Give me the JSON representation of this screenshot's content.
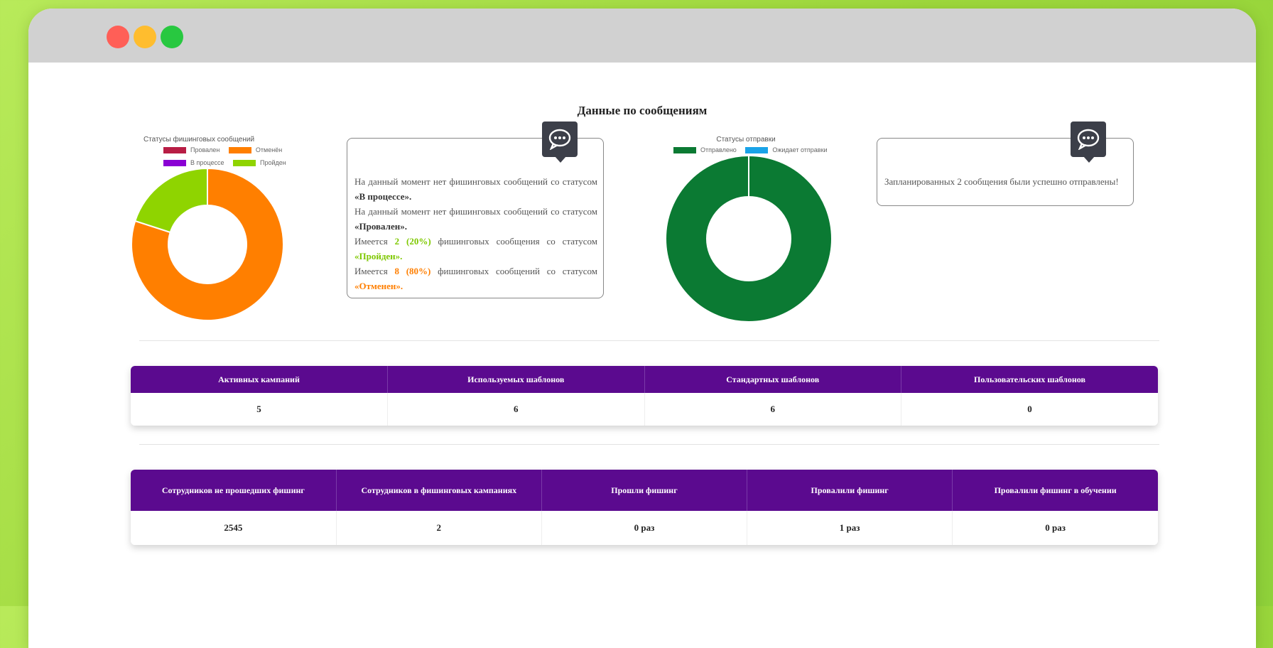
{
  "window": {
    "controls": {
      "close_color": "#ff5f57",
      "minimize_color": "#ffbd2e",
      "maximize_color": "#28c840"
    }
  },
  "section_title": "Данные по сообщениям",
  "phishing_status_chart": {
    "title": "Статусы фишинговых сообщений",
    "legend": [
      {
        "label": "Провален",
        "color": "#b81d45"
      },
      {
        "label": "Отменён",
        "color": "#ff7f00"
      },
      {
        "label": "В процессе",
        "color": "#8a00d4"
      },
      {
        "label": "Пройден",
        "color": "#8fd400"
      }
    ]
  },
  "send_status_chart": {
    "title": "Статусы отправки",
    "legend": [
      {
        "label": "Отправлено",
        "color": "#0b7a33"
      },
      {
        "label": "Ожидает отправки",
        "color": "#1aa3e8"
      }
    ]
  },
  "chart_data": [
    {
      "type": "pie",
      "title": "Статусы фишинговых сообщений",
      "categories": [
        "Провален",
        "Отменён",
        "В процессе",
        "Пройден"
      ],
      "values": [
        0,
        8,
        0,
        2
      ],
      "colors": [
        "#b81d45",
        "#ff7f00",
        "#8a00d4",
        "#8fd400"
      ],
      "legend": "top"
    },
    {
      "type": "pie",
      "title": "Статусы отправки",
      "categories": [
        "Отправлено",
        "Ожидает отправки"
      ],
      "values": [
        2,
        0
      ],
      "colors": [
        "#0b7a33",
        "#1aa3e8"
      ],
      "legend": "top"
    }
  ],
  "info_box_phishing": {
    "icon": "chat-bubble-icon",
    "line1_text": "На данный момент нет фишинговых сообщений со статусом ",
    "line1_status": "«В процессе».",
    "line2_text": "На данный момент нет фишинговых сообщений со статусом ",
    "line2_status": "«Провален».",
    "line3_prefix": "Имеется ",
    "line3_count": "2",
    "line3_percent": "(20%)",
    "line3_text": " фишинговых сообщения со статусом ",
    "line3_status": "«Пройден».",
    "line4_prefix": "Имеется ",
    "line4_count": "8",
    "line4_percent": "(80%)",
    "line4_text": " фишинговых сообщений со статусом ",
    "line4_status": "«Отменен».",
    "passed_color": "#7ec800",
    "cancelled_color": "#ff7f00"
  },
  "info_box_send": {
    "icon": "chat-bubble-icon",
    "text": "Запланированных 2 сообщения были успешно отправлены!"
  },
  "campaign_table": {
    "headers": [
      "Активных кампаний",
      "Используемых шаблонов",
      "Стандартных шаблонов",
      "Пользовательских шаблонов"
    ],
    "values": [
      "5",
      "6",
      "6",
      "0"
    ],
    "header_color": "#5b0a8f"
  },
  "employee_table": {
    "headers": [
      "Сотрудников не прошедших фишинг",
      "Сотрудников в фишинговых кампаниях",
      "Прошли фишинг",
      "Провалили фишинг",
      "Провалили фишинг в обучении"
    ],
    "values": [
      "2545",
      "2",
      "0 раз",
      "1 раз",
      "0 раз"
    ],
    "header_color": "#5b0a8f"
  }
}
